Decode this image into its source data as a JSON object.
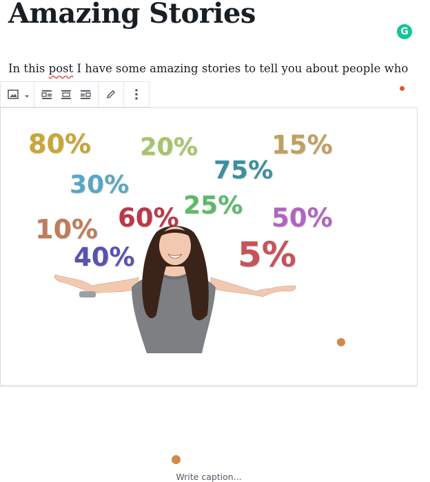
{
  "post": {
    "title": "Amazing Stories",
    "paragraph_before": "In this ",
    "paragraph_underlined": "post",
    "paragraph_after": " I have some amazing stories to tell you about people who have defied all the odds."
  },
  "grammarly": {
    "label": "G",
    "color": "#15c39a"
  },
  "toolbar": {
    "icons": [
      "image-icon",
      "chevron-down-icon",
      "align-left-icon",
      "align-center-icon",
      "align-right-icon",
      "pencil-icon",
      "more-vertical-icon"
    ]
  },
  "image": {
    "percentages": [
      {
        "text": "80%",
        "color": "#c9a53a"
      },
      {
        "text": "20%",
        "color": "#a8c46a"
      },
      {
        "text": "15%",
        "color": "#c0a060"
      },
      {
        "text": "75%",
        "color": "#3c8fa0"
      },
      {
        "text": "30%",
        "color": "#5aa6c4"
      },
      {
        "text": "25%",
        "color": "#5cb96a"
      },
      {
        "text": "60%",
        "color": "#b83a4a"
      },
      {
        "text": "50%",
        "color": "#b065c0"
      },
      {
        "text": "10%",
        "color": "#c07c5a"
      },
      {
        "text": "40%",
        "color": "#5a52b0"
      },
      {
        "text": "5%",
        "color": "#c5545a"
      }
    ]
  },
  "caption": {
    "placeholder": "Write caption..."
  }
}
